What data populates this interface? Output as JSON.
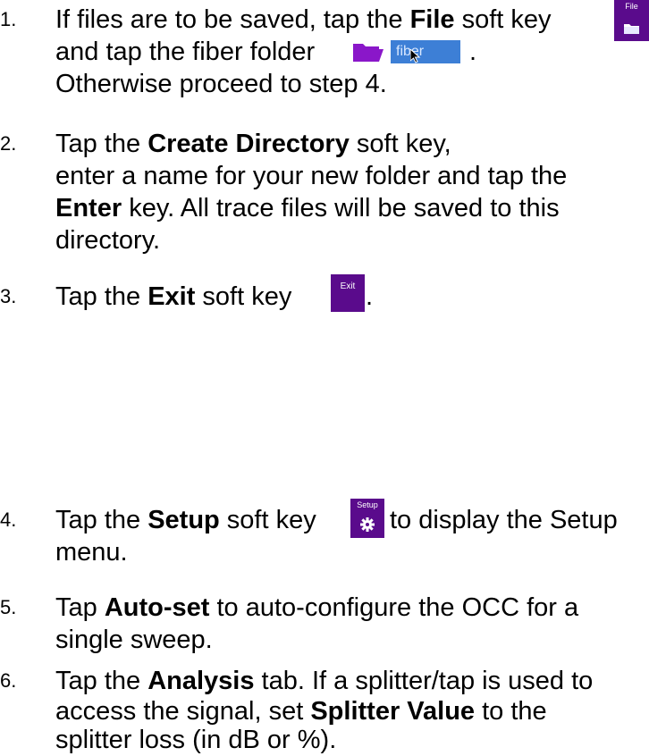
{
  "steps": [
    {
      "number": "1.",
      "lines": [
        {
          "before": "If files are to be saved, tap the ",
          "bold": "File",
          "after": " soft key"
        },
        {
          "before": "and tap the fiber folder",
          "bold": "",
          "after": "."
        },
        {
          "before": "Otherwise proceed to step 4.",
          "bold": "",
          "after": ""
        }
      ],
      "file_key_label": "File",
      "folder_chip_label": "fiber"
    },
    {
      "number": "2.",
      "lines": [
        {
          "before": "Tap the ",
          "bold": "Create Directory",
          "after": " soft key,"
        },
        {
          "before": "enter a name for your new folder and tap the",
          "bold": "",
          "after": ""
        },
        {
          "before": "",
          "bold": "Enter",
          "after": " key.  All trace files will be saved to this"
        },
        {
          "before": "directory.",
          "bold": "",
          "after": ""
        }
      ]
    },
    {
      "number": "3.",
      "lines": [
        {
          "before": "Tap the ",
          "bold": "Exit",
          "after": " soft key"
        }
      ],
      "exit_key_label": "Exit",
      "trailing": "."
    },
    {
      "number": "4.",
      "lines": [
        {
          "before": "Tap the ",
          "bold": "Setup",
          "after": " soft key"
        },
        {
          "before": "menu.",
          "bold": "",
          "after": ""
        }
      ],
      "setup_key_label": "Setup",
      "after_icon": "to display the Setup"
    },
    {
      "number": "5.",
      "lines": [
        {
          "before": "Tap ",
          "bold": "Auto-set",
          "after": " to auto-configure the OCC for a"
        },
        {
          "before": "single sweep.",
          "bold": "",
          "after": ""
        }
      ]
    },
    {
      "number": "6.",
      "lines": [
        {
          "before": "Tap the ",
          "bold": "Analysis",
          "after": " tab. If a splitter/tap is used to"
        },
        {
          "before": "access the signal, set ",
          "bold": "Splitter Value",
          "after": " to the"
        },
        {
          "before": "splitter loss (in dB or %).",
          "bold": "",
          "after": ""
        }
      ]
    }
  ],
  "colors": {
    "softkey_bg": "#5a0b8c",
    "folder_icon": "#8a17c9",
    "chip_bg": "#3d7fd6"
  },
  "icons": [
    "file-icon",
    "folder-icon",
    "mouse-pointer-icon",
    "gear-icon"
  ]
}
